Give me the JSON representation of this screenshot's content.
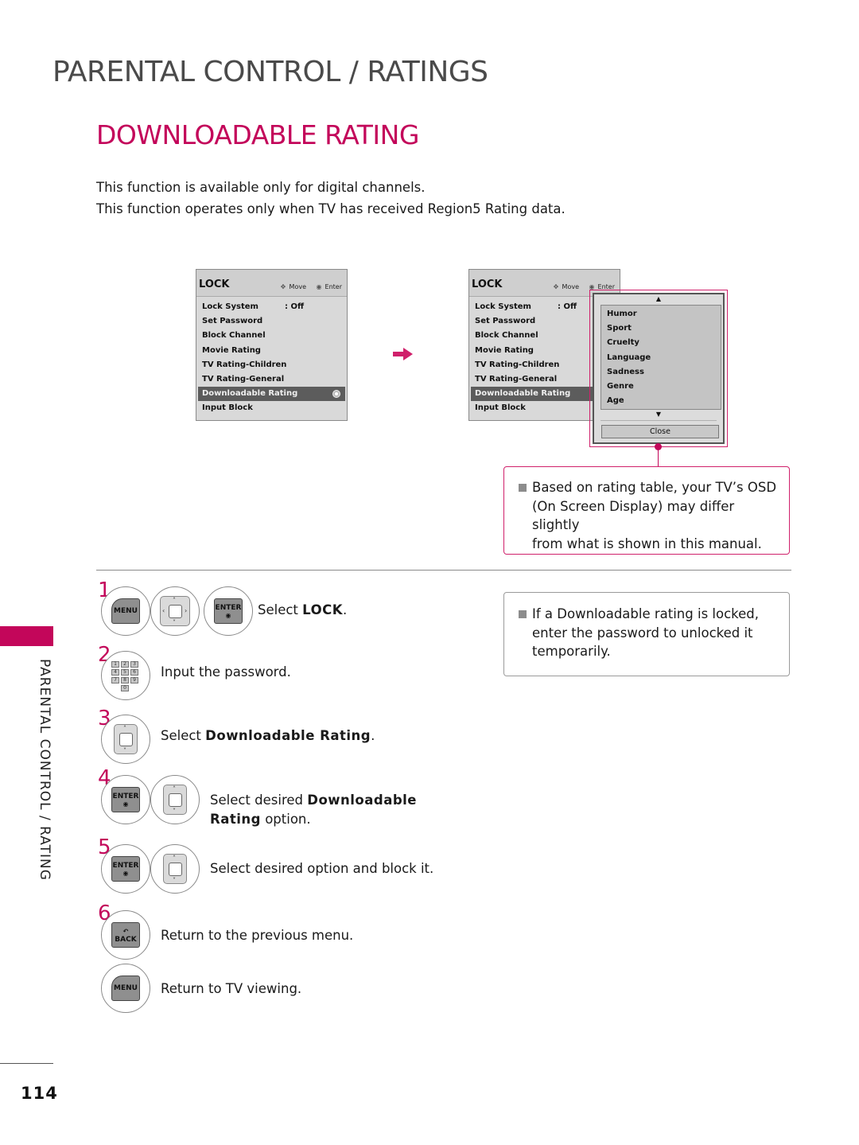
{
  "header": {
    "section_title": "PARENTAL CONTROL / RATINGS",
    "page_title": "DOWNLOADABLE RATING"
  },
  "intro": [
    "This function is available only for digital channels.",
    "This function operates only when TV has received Region5 Rating data."
  ],
  "osd_left": {
    "title": "LOCK",
    "hint_move": "Move",
    "hint_enter": "Enter",
    "items": [
      {
        "label": "Lock System",
        "value": ": Off"
      },
      {
        "label": "Set Password"
      },
      {
        "label": "Block Channel"
      },
      {
        "label": "Movie Rating"
      },
      {
        "label": "TV Rating-Children"
      },
      {
        "label": "TV Rating-General"
      },
      {
        "label": "Downloadable Rating",
        "selected": true
      },
      {
        "label": "Input Block"
      }
    ]
  },
  "osd_right": {
    "title": "LOCK",
    "hint_move": "Move",
    "hint_enter": "Enter",
    "items": [
      {
        "label": "Lock System",
        "value": ": Off"
      },
      {
        "label": "Set Password"
      },
      {
        "label": "Block Channel"
      },
      {
        "label": "Movie Rating"
      },
      {
        "label": "TV Rating-Children"
      },
      {
        "label": "TV Rating-General"
      },
      {
        "label": "Downloadable Rating",
        "selected": true
      },
      {
        "label": "Input Block"
      }
    ],
    "popup": {
      "options": [
        "Humor",
        "Sport",
        "Cruelty",
        "Language",
        "Sadness",
        "Genre",
        "Age"
      ],
      "close_label": "Close"
    }
  },
  "notes": {
    "osd_note": "Based on rating table, your TV’s OSD\n(On Screen Display) may differ slightly\nfrom what is shown in this manual.",
    "lock_note": "If a Downloadable rating is locked,\nenter the password to unlocked it\ntemporarily."
  },
  "side_label": "PARENTAL CONTROL / RATING",
  "page_number": "114",
  "buttons": {
    "menu": "MENU",
    "enter": "ENTER",
    "back": "BACK",
    "keypad": [
      "1",
      "2",
      "3",
      "4",
      "5",
      "6",
      "7",
      "8",
      "9",
      "0"
    ]
  },
  "steps": [
    {
      "number": "1",
      "prefix": "Select ",
      "bold": "LOCK",
      "suffix": "."
    },
    {
      "number": "2",
      "text": "Input the password."
    },
    {
      "number": "3",
      "prefix": "Select ",
      "bold": "Downloadable Rating",
      "suffix": "."
    },
    {
      "number": "4",
      "prefix": "Select desired ",
      "bold": "Downloadable",
      "bold2": "Rating",
      "suffix": " option."
    },
    {
      "number": "5",
      "text": "Select desired option and block it."
    },
    {
      "number": "6",
      "text": "Return to the previous menu."
    },
    {
      "number": "",
      "text": "Return to TV viewing."
    }
  ]
}
